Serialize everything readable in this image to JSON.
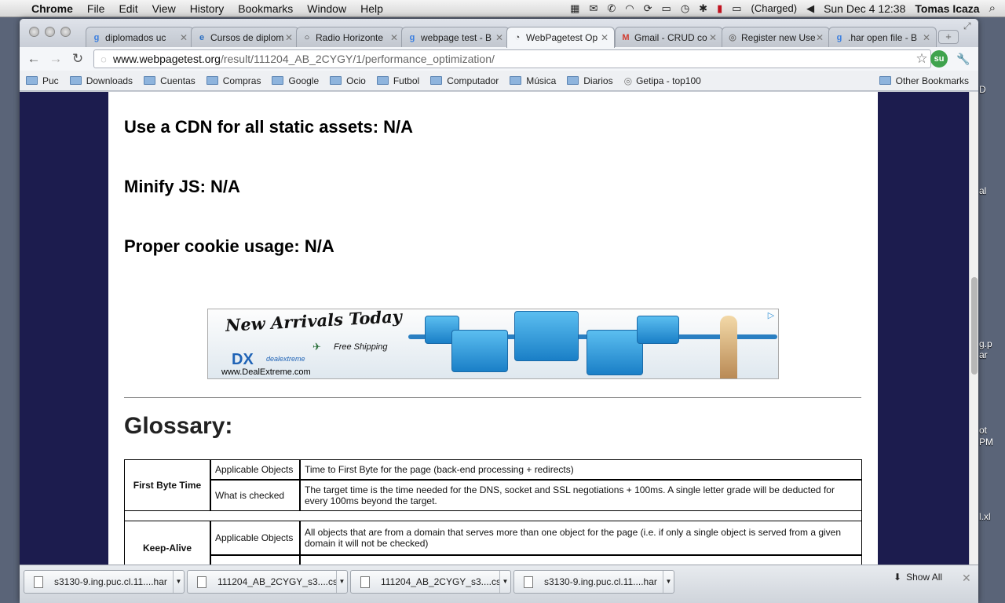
{
  "menubar": {
    "app": "Chrome",
    "items": [
      "File",
      "Edit",
      "View",
      "History",
      "Bookmarks",
      "Window",
      "Help"
    ],
    "battery": "(Charged)",
    "clock": "Sun Dec 4  12:38",
    "user": "Tomas Icaza"
  },
  "tabs": [
    {
      "title": "diplomados uc",
      "icon": "google-icon",
      "color": "#3a7ee0"
    },
    {
      "title": "Cursos de diplom",
      "icon": "ie-icon",
      "color": "#2a6fc2"
    },
    {
      "title": "Radio Horizonte",
      "icon": "circle-icon",
      "color": "#333333"
    },
    {
      "title": "webpage test - B",
      "icon": "google-icon",
      "color": "#3a7ee0"
    },
    {
      "title": "WebPagetest Op",
      "icon": "gauge-icon",
      "color": "#444444",
      "active": true
    },
    {
      "title": "Gmail - CRUD co",
      "icon": "gmail-icon",
      "color": "#d13b2f"
    },
    {
      "title": "Register new Use",
      "icon": "globe-icon",
      "color": "#777777"
    },
    {
      "title": ".har open file - B",
      "icon": "google-icon",
      "color": "#3a7ee0"
    }
  ],
  "address": {
    "host": "www.webpagetest.org",
    "path": "/result/111204_AB_2CYGY/1/performance_optimization/"
  },
  "bookmarks": [
    "Puc",
    "Downloads",
    "Cuentas",
    "Compras",
    "Google",
    "Ocio",
    "Futbol",
    "Computador",
    "Música",
    "Diarios",
    "Getipa - top100"
  ],
  "other_bookmarks": "Other Bookmarks",
  "page": {
    "headings": [
      "Use a CDN for all static assets: N/A",
      "Minify JS: N/A",
      "Proper cookie usage: N/A"
    ],
    "ad": {
      "title": "New Arrivals Today",
      "shipping": "Free Shipping",
      "brand": "DX",
      "brand_sub": "dealextreme",
      "url": "www.DealExtreme.com"
    },
    "glossary_title": "Glossary:",
    "glossary": [
      {
        "term": "First Byte Time",
        "rows": [
          {
            "label": "Applicable Objects",
            "text": "Time to First Byte for the page (back-end processing + redirects)"
          },
          {
            "label": "What is checked",
            "text": "The target time is the time needed for the DNS, socket and SSL negotiations + 100ms. A single letter grade will be deducted for every 100ms beyond the target."
          }
        ]
      },
      {
        "term": "Keep-Alive",
        "rows": [
          {
            "label": "Applicable Objects",
            "text": "All objects that are from a domain that serves more than one object for the page (i.e. if only a single object is served from a given domain it will not be checked)"
          },
          {
            "label": "",
            "text": ""
          }
        ]
      }
    ]
  },
  "downloads": [
    "s3130-9.ing.puc.cl.11....har",
    "111204_AB_2CYGY_s3....csv",
    "111204_AB_2CYGY_s3....csv",
    "s3130-9.ing.puc.cl.11....har"
  ],
  "show_all": "Show All",
  "desktop_labels": [
    "D",
    "al",
    "g.p",
    "ar",
    "ot",
    "PM",
    "l.xl"
  ]
}
